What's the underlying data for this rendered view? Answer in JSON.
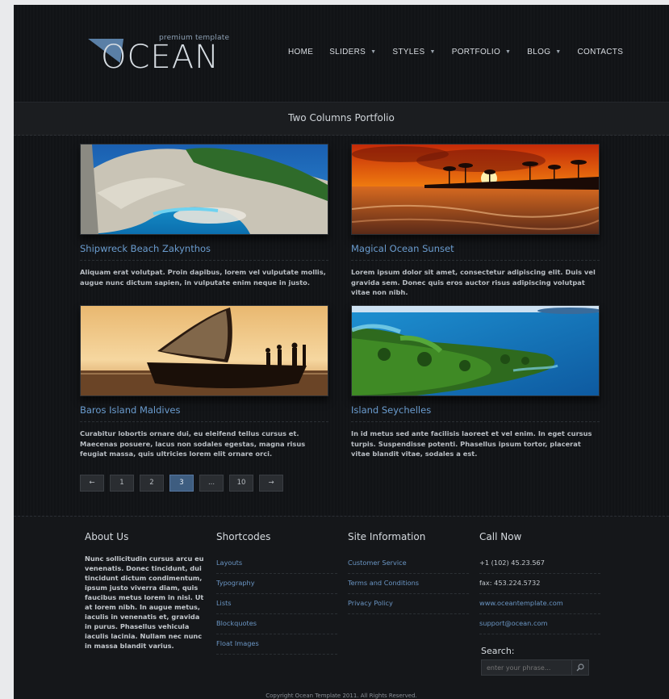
{
  "header": {
    "brand": "OCEAN",
    "tagline": "premium template",
    "nav": [
      {
        "label": "HOME",
        "dropdown": false
      },
      {
        "label": "SLIDERS",
        "dropdown": true
      },
      {
        "label": "STYLES",
        "dropdown": true
      },
      {
        "label": "PORTFOLIO",
        "dropdown": true
      },
      {
        "label": "BLOG",
        "dropdown": true
      },
      {
        "label": "CONTACTS",
        "dropdown": false
      }
    ]
  },
  "page_title": "Two Columns Portfolio",
  "portfolio": [
    {
      "title": "Shipwreck Beach Zakynthos",
      "description": "Aliquam erat volutpat. Proin dapibus, lorem vel vulputate mollis, augue nunc dictum sapien, in vulputate enim neque in justo.",
      "image": "cliff-beach"
    },
    {
      "title": "Magical Ocean Sunset",
      "description": "Lorem ipsum dolor sit amet, consectetur adipiscing elit. Duis vel gravida sem. Donec quis eros auctor risus adipiscing volutpat vitae non nibh.",
      "image": "sunset"
    },
    {
      "title": "Baros Island Maldives",
      "description": "Curabitur lobortis ornare dui, eu eleifend tellus cursus et. Maecenas posuere, lacus non sodales egestas, magna risus feugiat massa, quis ultricies lorem elit ornare orci.",
      "image": "sailboat"
    },
    {
      "title": "Island Seychelles",
      "description": "In id metus sed ante facilisis laoreet et vel enim. In eget cursus turpis. Suspendisse potenti. Phasellus ipsum tortor, placerat vitae blandit vitae, sodales a est.",
      "image": "island"
    }
  ],
  "pagination": {
    "items": [
      "←",
      "1",
      "2",
      "3",
      "...",
      "10",
      "→"
    ],
    "active": "3"
  },
  "footer": {
    "about": {
      "heading": "About Us",
      "text": "Nunc sollicitudin cursus arcu eu venenatis. Donec tincidunt, dui tincidunt dictum condimentum, ipsum justo viverra diam, quis faucibus metus lorem in nisi. Ut at lorem nibh. In augue metus, iaculis in venenatis et, gravida in purus. Phasellus vehicula iaculis lacinia. Nullam nec nunc in massa blandit varius."
    },
    "shortcodes": {
      "heading": "Shortcodes",
      "links": [
        "Layouts",
        "Typography",
        "Lists",
        "Blockquotes",
        "Float Images"
      ]
    },
    "site_info": {
      "heading": "Site Information",
      "links": [
        "Customer Service",
        "Terms and Conditions",
        "Privacy Policy"
      ]
    },
    "call_now": {
      "heading": "Call Now",
      "phone": "+1 (102) 45.23.567",
      "fax": "fax: 453.224.5732",
      "website": "www.oceantemplate.com",
      "email": "support@ocean.com"
    },
    "search": {
      "label": "Search:",
      "placeholder": "enter your phrase..."
    },
    "copyright": "Copyright Ocean Template 2011. All Rights Reserved."
  },
  "colors": {
    "background": "#111316",
    "link": "#6b9dd0",
    "active_page": "#3e5d80"
  }
}
